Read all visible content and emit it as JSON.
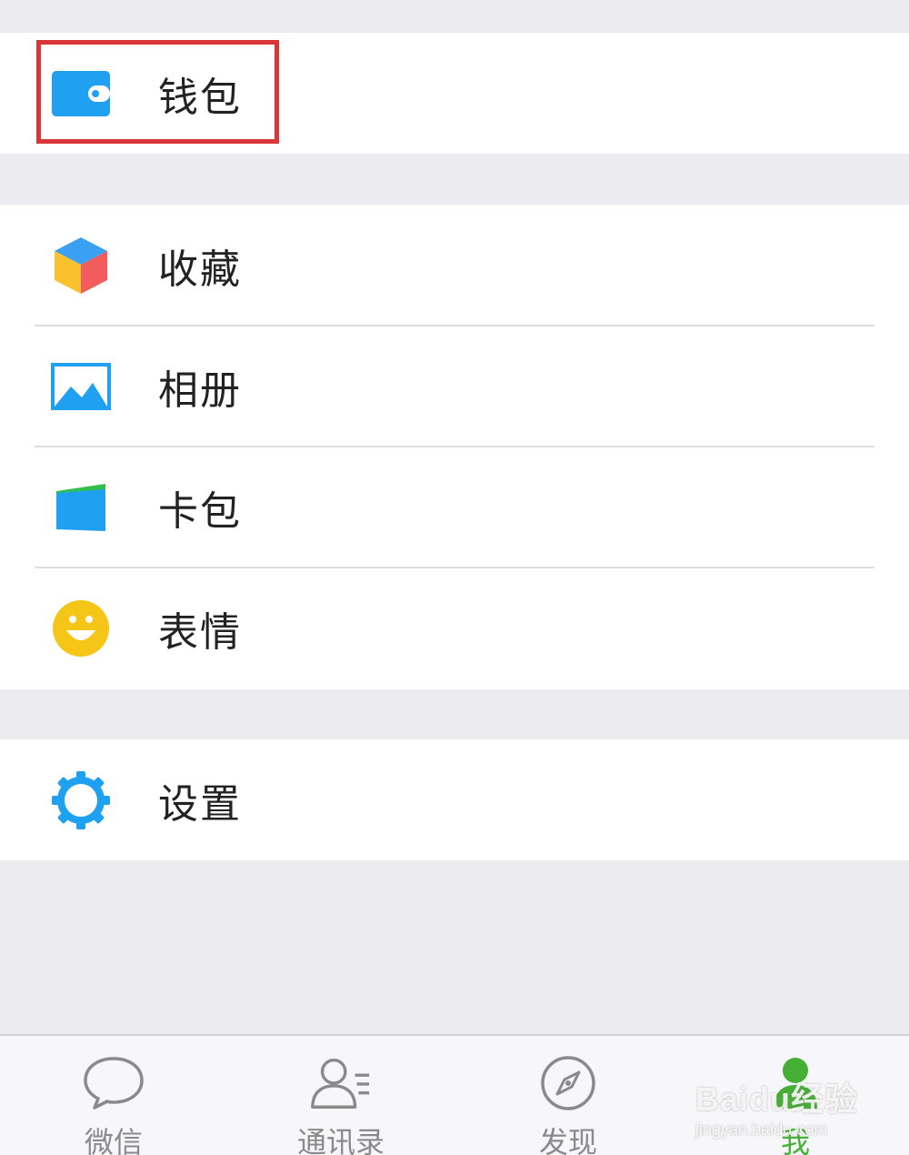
{
  "menu": {
    "wallet": {
      "label": "钱包",
      "icon": "wallet-icon"
    },
    "group2": [
      {
        "key": "favorites",
        "label": "收藏",
        "icon": "cube-icon"
      },
      {
        "key": "album",
        "label": "相册",
        "icon": "picture-icon"
      },
      {
        "key": "cards",
        "label": "卡包",
        "icon": "card-wallet-icon"
      },
      {
        "key": "stickers",
        "label": "表情",
        "icon": "smiley-icon"
      }
    ],
    "settings": {
      "label": "设置",
      "icon": "gear-icon"
    }
  },
  "tabs": [
    {
      "label": "微信",
      "icon": "chat-bubble-icon",
      "active": false
    },
    {
      "label": "通讯录",
      "icon": "contacts-icon",
      "active": false
    },
    {
      "label": "发现",
      "icon": "compass-icon",
      "active": false
    },
    {
      "label": "我",
      "icon": "person-icon",
      "active": true
    }
  ],
  "watermark": {
    "main": "Baidu经验",
    "sub": "jingyan.baidu.com"
  },
  "colors": {
    "background": "#ebebf0",
    "highlight": "#d9363a",
    "active_tab": "#45b035",
    "icon_blue": "#1fa0f0"
  }
}
